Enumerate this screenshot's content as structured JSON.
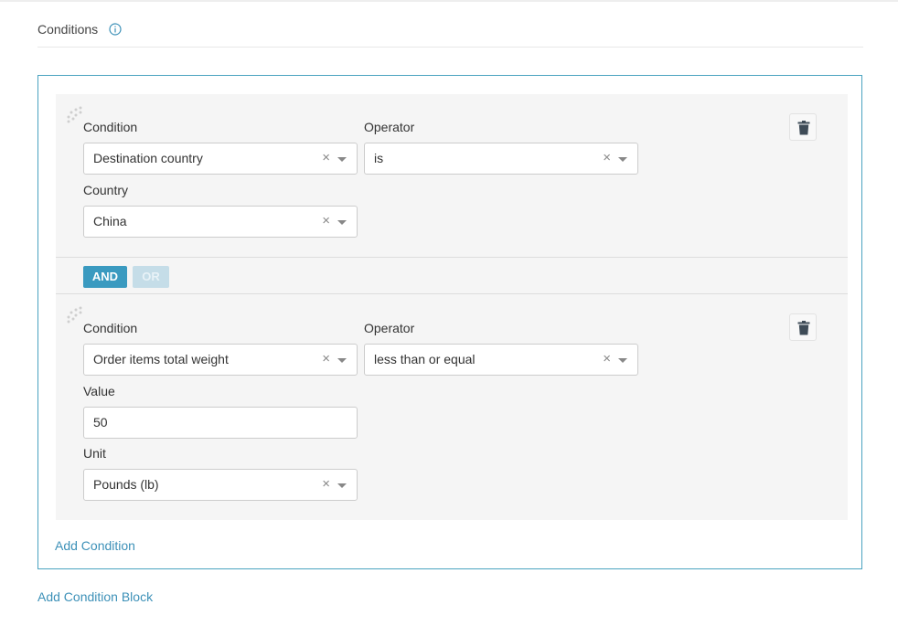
{
  "header": {
    "title": "Conditions",
    "info_icon": "info-circle-icon"
  },
  "blocks": [
    {
      "condition_label": "Condition",
      "condition_value": "Destination country",
      "operator_label": "Operator",
      "operator_value": "is",
      "field_label": "Country",
      "field_value": "China",
      "delete_icon": "trash-icon"
    },
    {
      "condition_label": "Condition",
      "condition_value": "Order items total weight",
      "operator_label": "Operator",
      "operator_value": "less than or equal",
      "value_label": "Value",
      "value_value": "50",
      "unit_label": "Unit",
      "unit_value": "Pounds (lb)",
      "delete_icon": "trash-icon"
    }
  ],
  "logic": {
    "and_label": "AND",
    "or_label": "OR",
    "selected": "AND"
  },
  "select_clear_glyph": "×",
  "add_condition_label": "Add Condition",
  "add_condition_block_label": "Add Condition Block",
  "colors": {
    "accent": "#3a9ac0",
    "link": "#3d91b8",
    "border": "#4aa3c0"
  }
}
